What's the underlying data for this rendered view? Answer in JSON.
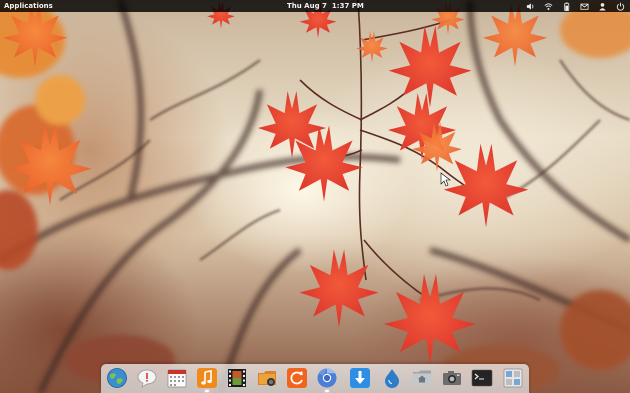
{
  "top_panel": {
    "applications_label": "Applications",
    "clock": {
      "date": "Thu Aug 7",
      "time": "1:37 PM"
    },
    "indicators": [
      {
        "name": "sound",
        "icon": "speaker-icon"
      },
      {
        "name": "network",
        "icon": "wifi-icon"
      },
      {
        "name": "battery",
        "icon": "battery-icon"
      },
      {
        "name": "messages",
        "icon": "mail-icon"
      },
      {
        "name": "user",
        "icon": "user-icon"
      },
      {
        "name": "session",
        "icon": "power-icon"
      }
    ]
  },
  "dock": {
    "items": [
      {
        "name": "midori-browser",
        "icon": "globe-icon"
      },
      {
        "name": "chat",
        "icon": "chat-bubble-icon"
      },
      {
        "name": "calendar",
        "icon": "calendar-icon"
      },
      {
        "name": "music",
        "icon": "music-note-icon"
      },
      {
        "name": "videos",
        "icon": "film-icon"
      },
      {
        "name": "photos",
        "icon": "photo-icon"
      },
      {
        "name": "update-manager",
        "icon": "refresh-icon"
      },
      {
        "name": "chromium",
        "icon": "chromium-icon"
      },
      {
        "name": "software-center",
        "icon": "download-icon"
      },
      {
        "name": "mail",
        "icon": "droplet-icon"
      },
      {
        "name": "files",
        "icon": "home-folder-icon"
      },
      {
        "name": "screenshot",
        "icon": "camera-icon"
      },
      {
        "name": "terminal",
        "icon": "terminal-icon"
      },
      {
        "name": "system-settings",
        "icon": "settings-icon"
      }
    ],
    "running": [
      "music",
      "chromium"
    ]
  }
}
